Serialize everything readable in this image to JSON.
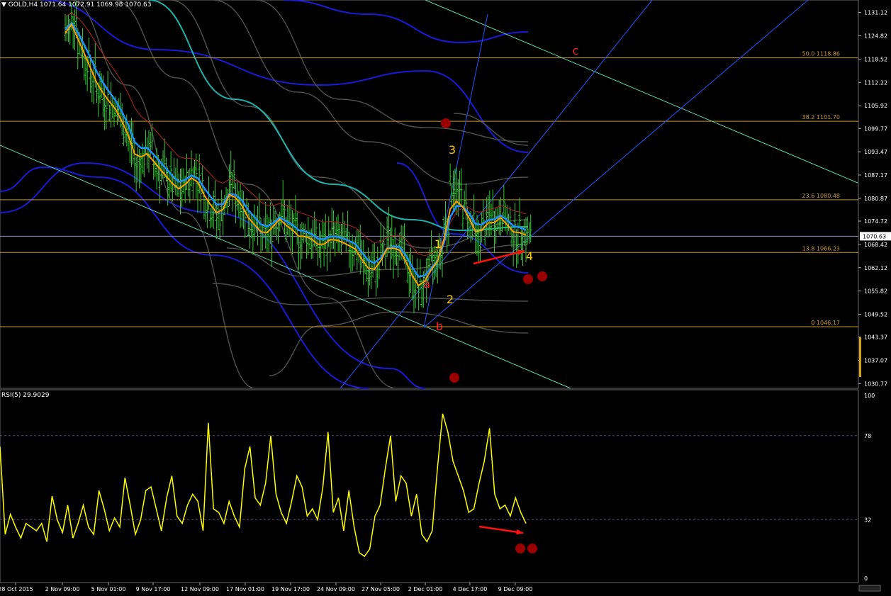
{
  "header": {
    "symbol": "GOLD,H4",
    "ohlc": "1071.64 1072.91 1069.98 1070.63"
  },
  "rsi_header": {
    "label": "RSI(5) 29.9029"
  },
  "colors": {
    "background": "#000000",
    "bar": "#32cd32",
    "ema_fast": "#ff9f00",
    "ema_mid": "#1e90ff",
    "ema_slow": "#b22222",
    "ma_long": "#20b2aa",
    "envelope_blue": "#1a1ad6",
    "envelope_gray": "#4a4f4a",
    "fib": "#c8962a",
    "channel": "#5fd3b3",
    "fan": "#2255ff",
    "wave_label": "#ffc800",
    "abc_label": "#ff2020",
    "marker": "#9b0000",
    "rsi_line": "#ffff00",
    "arrow": "#ff1010",
    "price_tag_bg": "#ffffff"
  },
  "chart_data": [
    {
      "type": "candlestick",
      "title": "GOLD,H4",
      "x_ticks": [
        "28 Oct 2015",
        "2 Nov 09:00",
        "5 Nov 01:00",
        "9 Nov 17:00",
        "12 Nov 09:00",
        "17 Nov 01:00",
        "19 Nov 17:00",
        "24 Nov 09:00",
        "27 Nov 05:00",
        "2 Dec 01:00",
        "4 Dec 17:00",
        "9 Dec 09:00"
      ],
      "y_ticks": [
        1131.12,
        1124.82,
        1118.52,
        1112.22,
        1105.92,
        1099.77,
        1093.47,
        1087.17,
        1080.87,
        1074.72,
        1068.42,
        1062.12,
        1055.82,
        1049.52,
        1043.37,
        1037.07,
        1030.77
      ],
      "ylim": [
        1029.5,
        1134.5
      ],
      "current_price": "1070.63",
      "close_series": [
        1126,
        1130,
        1122,
        1118,
        1114,
        1110,
        1108,
        1106,
        1104,
        1100,
        1096,
        1090,
        1092,
        1094,
        1090,
        1088,
        1086,
        1084,
        1083,
        1086,
        1088,
        1085,
        1080,
        1078,
        1076,
        1079,
        1085,
        1081,
        1078,
        1074,
        1073,
        1071,
        1072,
        1075,
        1077,
        1073,
        1072,
        1070,
        1071,
        1070,
        1068,
        1069,
        1071,
        1070,
        1069,
        1068,
        1067,
        1063,
        1061,
        1062,
        1066,
        1070,
        1068,
        1067,
        1062,
        1058,
        1056,
        1060,
        1064,
        1066,
        1074,
        1084,
        1082,
        1078,
        1074,
        1070,
        1073,
        1076,
        1075,
        1077,
        1073,
        1071,
        1072,
        1071
      ],
      "fib_levels": [
        {
          "label": "50.0 1118.86",
          "value": 1118.86
        },
        {
          "label": "38.2 1101.70",
          "value": 1101.7
        },
        {
          "label": "23.6 1080.48",
          "value": 1080.48
        },
        {
          "label": "13.8 1066.23",
          "value": 1066.23
        },
        {
          "label": "0 1046.17",
          "value": 1046.17
        }
      ],
      "wave_labels": [
        {
          "text": "1",
          "role": "impulse"
        },
        {
          "text": "2",
          "role": "impulse"
        },
        {
          "text": "3",
          "role": "impulse"
        },
        {
          "text": "4",
          "role": "impulse"
        },
        {
          "text": "a",
          "role": "correction"
        },
        {
          "text": "b",
          "role": "correction"
        },
        {
          "text": "c",
          "role": "correction"
        }
      ]
    },
    {
      "type": "line",
      "title": "RSI(5) 29.9029",
      "y_ticks": [
        100,
        78,
        32,
        0
      ],
      "levels": [
        78,
        32
      ],
      "ylim": [
        0,
        100
      ],
      "series": [
        {
          "name": "RSI(5)",
          "values": [
            72,
            24,
            35,
            28,
            22,
            30,
            28,
            26,
            30,
            20,
            45,
            32,
            25,
            40,
            22,
            30,
            40,
            28,
            24,
            48,
            38,
            26,
            33,
            28,
            55,
            40,
            24,
            32,
            48,
            50,
            38,
            26,
            44,
            56,
            34,
            30,
            40,
            46,
            42,
            26,
            85,
            38,
            36,
            30,
            42,
            34,
            28,
            60,
            72,
            44,
            40,
            52,
            78,
            46,
            36,
            30,
            42,
            56,
            50,
            34,
            38,
            32,
            50,
            80,
            36,
            44,
            26,
            48,
            28,
            14,
            12,
            16,
            34,
            40,
            60,
            78,
            42,
            56,
            52,
            34,
            46,
            24,
            20,
            26,
            60,
            90,
            80,
            64,
            56,
            48,
            36,
            38,
            52,
            64,
            82,
            46,
            38,
            40,
            34,
            44,
            36,
            30
          ]
        }
      ]
    }
  ]
}
